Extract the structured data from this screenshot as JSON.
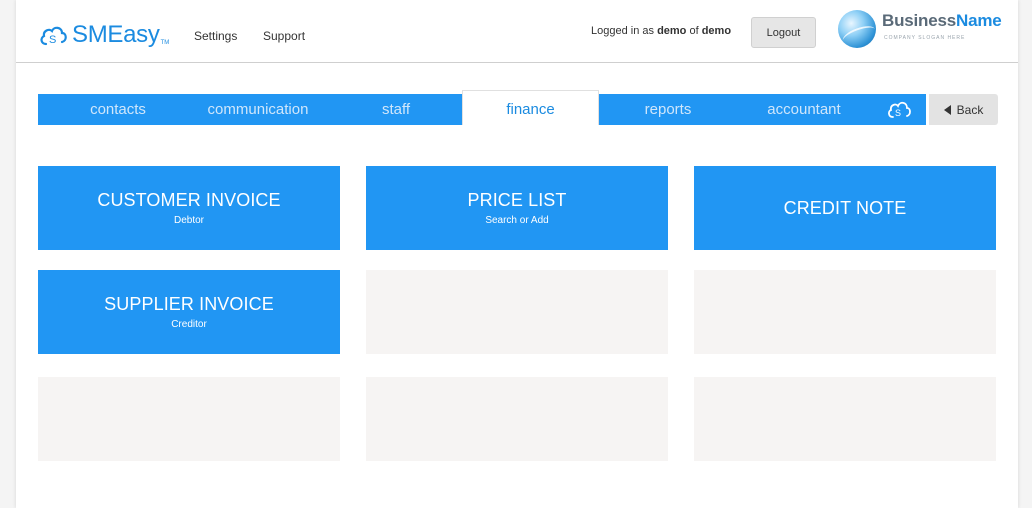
{
  "header": {
    "logo_text": "SMEasy",
    "logo_tm": "TM",
    "nav": {
      "settings": "Settings",
      "support": "Support"
    },
    "login": {
      "prefix": "Logged in as ",
      "user": "demo",
      "middle": " of ",
      "company": "demo"
    },
    "logout_label": "Logout",
    "brand": {
      "name_part1": "Business",
      "name_part2": "Name",
      "slogan": "COMPANY SLOGAN HERE"
    }
  },
  "tabs": [
    {
      "label": "contacts"
    },
    {
      "label": "communication"
    },
    {
      "label": "staff"
    },
    {
      "label": "finance",
      "active": true
    },
    {
      "label": "reports"
    },
    {
      "label": "accountant"
    }
  ],
  "back_label": "Back",
  "tiles": [
    {
      "title": "CUSTOMER INVOICE",
      "subtitle": "Debtor"
    },
    {
      "title": "PRICE LIST",
      "subtitle": "Search or Add"
    },
    {
      "title": "CREDIT NOTE",
      "subtitle": ""
    },
    {
      "title": "SUPPLIER INVOICE",
      "subtitle": "Creditor"
    }
  ],
  "colors": {
    "accent": "#2196f3",
    "empty_tile": "#f6f4f3"
  },
  "icons": {
    "logo": "smeasy-cloud-icon",
    "tab_cloud": "cloud-icon",
    "back": "triangle-left-icon"
  }
}
